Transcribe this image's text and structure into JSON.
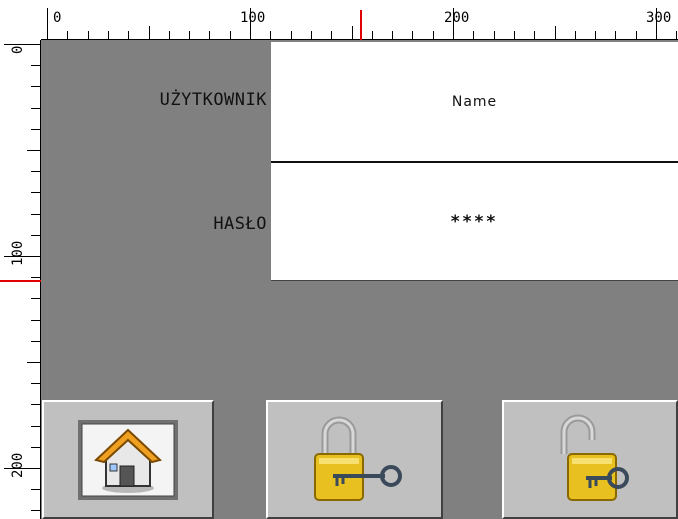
{
  "ruler": {
    "top_labels": [
      "0",
      "100",
      "200",
      "300"
    ],
    "left_labels": [
      "0",
      "100",
      "200"
    ],
    "marker_color": "#e00000"
  },
  "form": {
    "username_label": "UŻYTKOWNIK",
    "username_value": "Name",
    "password_label": "HASŁO",
    "password_value": "****"
  },
  "buttons": {
    "home_icon": "home-icon",
    "login_icon": "padlock-closed-key-icon",
    "logout_icon": "padlock-open-key-icon"
  },
  "colors": {
    "canvas_bg": "#808080",
    "field_bg": "#ffffff",
    "button_face": "#c0c0c0",
    "lock_gold": "#e8c020"
  }
}
